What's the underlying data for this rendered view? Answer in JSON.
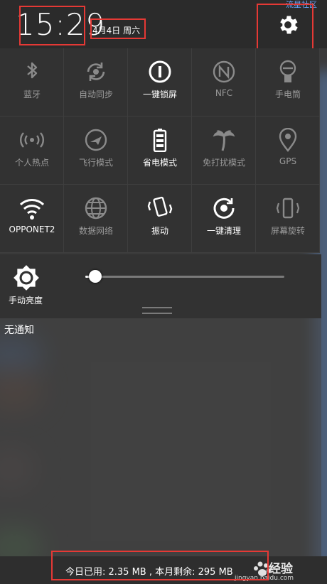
{
  "status": {
    "time": "15:29",
    "date": "4月4日 周六",
    "corner_text": "流星社区"
  },
  "toggles": [
    {
      "label": "蓝牙",
      "icon": "bluetooth-icon",
      "active": false
    },
    {
      "label": "自动同步",
      "icon": "sync-icon",
      "active": false
    },
    {
      "label": "一键锁屏",
      "icon": "lock-screen-icon",
      "active": true
    },
    {
      "label": "NFC",
      "icon": "nfc-icon",
      "active": false
    },
    {
      "label": "手电筒",
      "icon": "flashlight-icon",
      "active": false
    },
    {
      "label": "个人热点",
      "icon": "hotspot-icon",
      "active": false
    },
    {
      "label": "飞行模式",
      "icon": "airplane-icon",
      "active": false
    },
    {
      "label": "省电模式",
      "icon": "battery-saver-icon",
      "active": true
    },
    {
      "label": "免打扰模式",
      "icon": "palm-tree-icon",
      "active": false
    },
    {
      "label": "GPS",
      "icon": "location-pin-icon",
      "active": false
    },
    {
      "label": "OPPONET2",
      "icon": "wifi-icon",
      "active": true
    },
    {
      "label": "数据网络",
      "icon": "globe-icon",
      "active": false
    },
    {
      "label": "振动",
      "icon": "vibrate-icon",
      "active": true
    },
    {
      "label": "一键清理",
      "icon": "clean-icon",
      "active": true
    },
    {
      "label": "屏幕旋转",
      "icon": "rotate-screen-icon",
      "active": false
    }
  ],
  "brightness": {
    "label": "手动亮度",
    "level": 0.05
  },
  "notifications": {
    "title": "无通知"
  },
  "footer": {
    "usage_text": "今日已用: 2.35 MB , 本月剩余: 295 MB",
    "watermark_text": "经验",
    "watermark_url": "jingyan.baidu.com"
  }
}
